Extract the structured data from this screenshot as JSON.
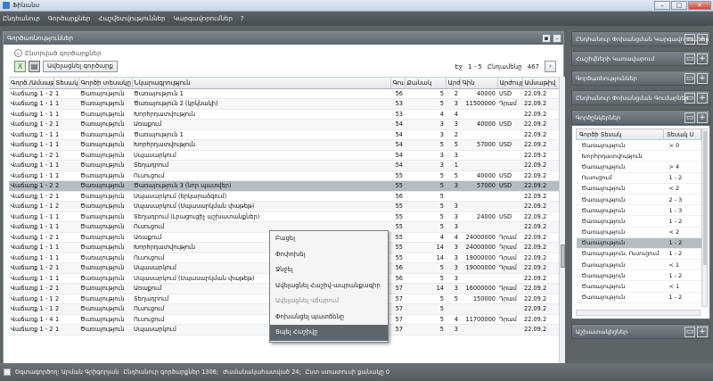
{
  "window": {
    "title": "Ֆինանս"
  },
  "menu": [
    "Ընդհանուր",
    "Գործարքներ",
    "Հաշվետվություններ",
    "Կարգավորումներ",
    "?"
  ],
  "main_panel": {
    "title": "Գործառնություններ",
    "filter_label": "Ընտրված գործարքներ",
    "add_button": "Ավելացնել գործարք",
    "pager": {
      "label": "Էջ",
      "range": "1 - 5",
      "total_label": "Ընդամենը",
      "total": "467"
    },
    "columns": [
      "Գործ./Ամսաթիվ",
      "Տեսակ",
      "Գործի տեսակը",
      "Նկարագրություն",
      "Գումար",
      "Քանակ",
      "Արժեք",
      "Գին",
      "Արժույթ",
      "Ամսաթիվ"
    ],
    "rows": [
      [
        "Վաճառք 1 - 2",
        "1",
        "Ծառայություն",
        "Ծառայություն 1",
        "56",
        "5",
        "2",
        "40000",
        "USD",
        "22.09.2"
      ],
      [
        "Վաճառք 1 - 1",
        "1",
        "Ծառայություն",
        "Ծառայություն 2 (կրկնակի)",
        "53",
        "5",
        "3",
        "11500000",
        "Դրամ",
        "22.09.2"
      ],
      [
        "Վաճառք 1 - 1",
        "1",
        "Ծառայություն",
        "Խորհրդատվություն",
        "53",
        "4",
        "4",
        "",
        "",
        "22.09.2"
      ],
      [
        "Վաճառք 1 - 2",
        "1",
        "Ծառայություն",
        "Առաքում",
        "54",
        "3",
        "3",
        "40000",
        "USD",
        "22.09.2"
      ],
      [
        "Վաճառք 1 - 1",
        "1",
        "Ծառայություն",
        "Ծառայություն 1",
        "54",
        "3",
        "2",
        "",
        "",
        "22.09.2"
      ],
      [
        "Վաճառք 1 - 1",
        "1",
        "Ծառայություն",
        "Խորհրդատվություն",
        "54",
        "5",
        "5",
        "57000",
        "USD",
        "22.09.2"
      ],
      [
        "Վաճառք 1 - 2",
        "1",
        "Ծառայություն",
        "Սպասարկում",
        "54",
        "3",
        "3",
        "",
        "",
        "22.09.2"
      ],
      [
        "Վաճառք 1 - 1",
        "1",
        "Ծառայություն",
        "Տեղադրում",
        "54",
        "3",
        "1",
        "",
        "",
        "22.09.2"
      ],
      [
        "Վաճառք 1 - 1",
        "1",
        "Ծառայություն",
        "Ուսուցում",
        "55",
        "5",
        "5",
        "40000",
        "USD",
        "22.09.2"
      ],
      [
        "Վաճառք 1 - 2",
        "2",
        "Ծառայություն",
        "Ծառայություն 3 (նոր պատվեր)",
        "55",
        "5",
        "3",
        "57000",
        "USD",
        "22.09.2"
      ],
      [
        "Վաճառք 1 - 2",
        "1",
        "Ծառայություն",
        "Սպասարկում (երկարաձգում)",
        "56",
        "5",
        "",
        "",
        "",
        "22.09.2"
      ],
      [
        "Վաճառք 1 - 1",
        "2",
        "Ծառայություն",
        "Սպասարկում (Սպասարկման փաթեթ)",
        "55",
        "5",
        "3",
        "",
        "",
        "22.09.2"
      ],
      [
        "Վաճառք 1 - 1",
        "1",
        "Ծառայություն",
        "Տեղադրում (Լրացուցիչ աշխատանքներ)",
        "55",
        "5",
        "3",
        "24000",
        "USD",
        "22.09.2"
      ],
      [
        "Վաճառք 1 - 1",
        "1",
        "Ծառայություն",
        "Ուսուցում",
        "55",
        "5",
        "3",
        "",
        "",
        "22.09.2"
      ],
      [
        "Վաճառք 1 - 2",
        "1",
        "Ծառայություն",
        "Առաքում",
        "55",
        "4",
        "4",
        "24000000",
        "Դրամ",
        "22.09.2"
      ],
      [
        "Վաճառք 1 - 1",
        "1",
        "Ծառայություն",
        "Խորհրդատվություն",
        "55",
        "14",
        "3",
        "24000000",
        "Դրամ",
        "22.09.2"
      ],
      [
        "Վաճառք 1 - 1",
        "1",
        "Ծառայություն",
        "Ուսուցում",
        "55",
        "14",
        "3",
        "19000000",
        "Դրամ",
        "22.09.2"
      ],
      [
        "Վաճառք 1 - 2",
        "1",
        "Ծառայություն",
        "Սպասարկում",
        "56",
        "5",
        "3",
        "19000000",
        "Դրամ",
        "22.09.2"
      ],
      [
        "Վաճառք 1 - 1",
        "1",
        "Ծառայություն",
        "Սպասարկում (Սպասարկման փաթեթ)",
        "56",
        "5",
        "3",
        "",
        "",
        "22.09.2"
      ],
      [
        "Վաճառք 1 - 2",
        "1",
        "Ծառայություն",
        "Առաքում",
        "57",
        "14",
        "3",
        "16000000",
        "Դրամ",
        "22.09.2"
      ],
      [
        "Վաճառք 1 - 1",
        "2",
        "Ծառայություն",
        "Տեղադրում",
        "57",
        "5",
        "5",
        "150000",
        "Դրամ",
        "22.09.2"
      ],
      [
        "Վաճառք 1 - 1",
        "2",
        "Ծառայություն",
        "Ուսուցում",
        "57",
        "5",
        "",
        "",
        "",
        "22.09.2"
      ],
      [
        "Վաճառք 1 - 4",
        "1",
        "Ծառայություն",
        "Ուսուցում",
        "57",
        "5",
        "4",
        "11700000",
        "Դրամ",
        "22.09.2"
      ],
      [
        "Վաճառք 1 - 2",
        "1",
        "Ծառայություն",
        "Սպասարկում",
        "57",
        "5",
        "3",
        "",
        "",
        "22.09.2"
      ]
    ],
    "selected_row": 9
  },
  "context_menu": [
    {
      "label": "Բացել",
      "state": "normal"
    },
    {
      "label": "Փոփոխել",
      "state": "normal"
    },
    {
      "label": "Ջնջել",
      "state": "normal"
    },
    {
      "label": "Ավելացնել Հաշիվ-ապրանքագիր",
      "state": "normal"
    },
    {
      "label": "Ավելացնել Վճարում",
      "state": "dim"
    },
    {
      "label": "Փոխանցել պատճենը",
      "state": "normal"
    },
    {
      "label": "Տպել Հաշիվը",
      "state": "hot"
    }
  ],
  "side_panels": [
    {
      "title": "Ընդհանուր Փոխանցման Կարգավորումներ",
      "expanded": false
    },
    {
      "title": "Հաշիվների Կառավարում",
      "expanded": false
    },
    {
      "title": "Գործառնություններ",
      "expanded": false
    },
    {
      "title": "Ընդհանուր Փոխանցման Գումարներ",
      "expanded": false
    },
    {
      "title": "Գործընկերներ",
      "expanded": true
    },
    {
      "title": "Աշխատակիցներ",
      "expanded": false
    }
  ],
  "partners": {
    "columns": [
      "Գործի Տեսակ",
      "Տեսակ Ս"
    ],
    "rows": [
      [
        "Ծառայություն",
        "> 0"
      ],
      [
        "Խորհրդատվություն",
        ""
      ],
      [
        "Ծառայություն",
        "> 4"
      ],
      [
        "Ուսուցում",
        "1 - 2"
      ],
      [
        "Ծառայություն",
        "< 2"
      ],
      [
        "Ծառայություն",
        "2 - 3"
      ],
      [
        "Ծառայություն",
        "1 - 3"
      ],
      [
        "Ծառայություն",
        "1 - 2"
      ],
      [
        "Ծառայություն",
        "< 2"
      ],
      [
        "Ծառայություն",
        "1 - 2"
      ],
      [
        "Ծառայություն, Ուսուցում",
        "1 - 2"
      ],
      [
        "Ծառայություն",
        "< 1"
      ],
      [
        "Ծառայություն",
        "1 - 2"
      ],
      [
        "Ծառայություն",
        "< 1"
      ],
      [
        "Ծառայություն",
        "1 - 2"
      ]
    ],
    "selected_row": 9
  },
  "status": {
    "user": "Օգտագործող: Արման Գրիգորյան",
    "records": "Ընդհանուր գործարքներ 1306;",
    "period": "Ժամանակահատված 24;",
    "misc": "Ըստ ստատուսի քանակը 0"
  }
}
